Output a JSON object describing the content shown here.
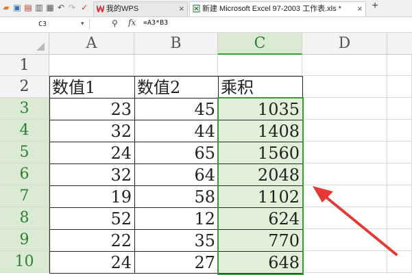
{
  "tabs": [
    {
      "label": "我的WPS",
      "active": false
    },
    {
      "label": "新建 Microsoft Excel 97-2003 工作表.xls *",
      "active": true
    }
  ],
  "tab_close_glyph": "×",
  "add_tab_glyph": "+",
  "name_box": "C3",
  "formula": "=A3*B3",
  "fx_label": "fx",
  "columns": [
    "A",
    "B",
    "C",
    "D"
  ],
  "rows": [
    {
      "num": "1",
      "a": "",
      "b": "",
      "c": ""
    },
    {
      "num": "2",
      "a": "数值1",
      "b": "数值2",
      "c": "乘积"
    },
    {
      "num": "3",
      "a": "23",
      "b": "45",
      "c": "1035"
    },
    {
      "num": "4",
      "a": "32",
      "b": "44",
      "c": "1408"
    },
    {
      "num": "5",
      "a": "24",
      "b": "65",
      "c": "1560"
    },
    {
      "num": "6",
      "a": "32",
      "b": "64",
      "c": "2048"
    },
    {
      "num": "7",
      "a": "19",
      "b": "58",
      "c": "1102"
    },
    {
      "num": "8",
      "a": "52",
      "b": "12",
      "c": "624"
    },
    {
      "num": "9",
      "a": "22",
      "b": "35",
      "c": "770"
    },
    {
      "num": "10",
      "a": "24",
      "b": "27",
      "c": "648"
    }
  ],
  "colors": {
    "selection": "#3a9a3a",
    "selection_fill": "#e2efd9",
    "arrow": "#e53935"
  }
}
